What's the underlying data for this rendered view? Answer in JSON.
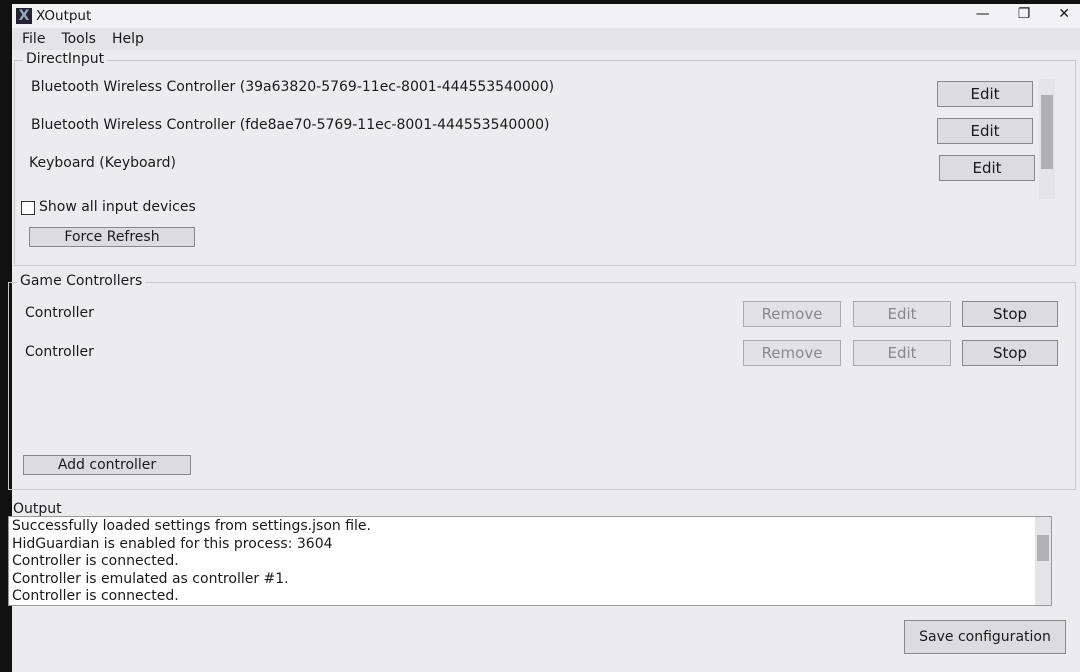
{
  "window": {
    "title": "XOutput",
    "controls": [
      "—",
      "❐",
      "✕"
    ]
  },
  "menu": [
    "File",
    "Tools",
    "Help"
  ],
  "direct_input": {
    "label": "DirectInput",
    "devices": [
      {
        "name": "Bluetooth Wireless Controller (39a63820-5769-11ec-8001-444553540000)",
        "edit": "Edit"
      },
      {
        "name": "Bluetooth Wireless Controller (fde8ae70-5769-11ec-8001-444553540000)",
        "edit": "Edit"
      },
      {
        "name": "Keyboard (Keyboard)",
        "edit": "Edit"
      }
    ],
    "show_all": "Show all input devices",
    "show_all_checked": false,
    "refresh": "Force Refresh"
  },
  "game_controllers": {
    "label": "Game Controllers",
    "items": [
      {
        "name": "Controller",
        "remove": "Remove",
        "edit": "Edit",
        "stop": "Stop"
      },
      {
        "name": "Controller",
        "remove": "Remove",
        "edit": "Edit",
        "stop": "Stop"
      }
    ],
    "add": "Add controller"
  },
  "output": {
    "label": "Output",
    "lines": [
      "Successfully loaded settings from settings.json file.",
      "HidGuardian is enabled for this process: 3604",
      "Controller is connected.",
      "Controller is emulated as controller #1.",
      "Controller is connected."
    ]
  },
  "save": "Save configuration"
}
